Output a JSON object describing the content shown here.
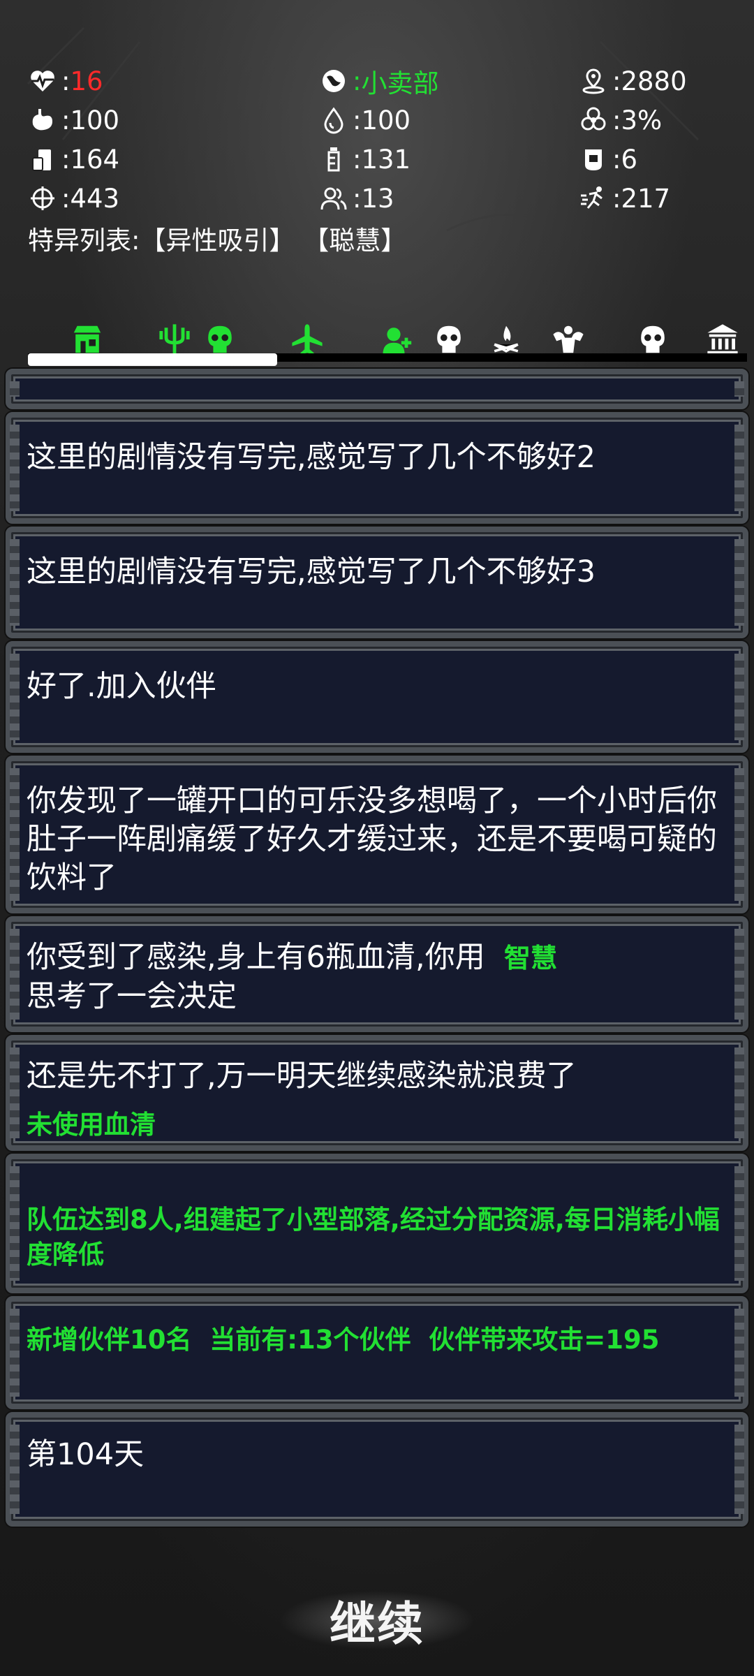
{
  "stats": {
    "health": "16",
    "location": "小卖部",
    "distance": "2880",
    "hunger": "100",
    "thirst": "100",
    "infection": "3%",
    "food": "164",
    "water": "131",
    "serum": "6",
    "attack": "443",
    "companions": "13",
    "speed": "217"
  },
  "stat_icons": [
    "heart-pulse-icon",
    "world-icon",
    "map-pin-icon",
    "stomach-icon",
    "water-drop-icon",
    "biohazard-icon",
    "food-can-icon",
    "water-bottle-icon",
    "serum-bag-icon",
    "crosshair-icon",
    "group-icon",
    "running-icon"
  ],
  "traits": {
    "label": "特异列表:",
    "values": "【异性吸引】 【聪慧】"
  },
  "tabs": [
    "store-icon",
    "trident-icon",
    "skull-icon",
    "airplane-icon",
    "add-user-icon",
    "skull-icon",
    "bonfire-icon",
    "muscle-icon",
    "skull-icon",
    "bank-icon"
  ],
  "tab_progress": 0.33,
  "colors": {
    "accent_green": "#22e033",
    "danger_red": "#ff2a2a",
    "card_bg": "#151a2e"
  },
  "log": {
    "entry1": "这里的剧情没有写完,感觉写了几个不够好2",
    "entry2": "这里的剧情没有写完,感觉写了几个不够好3",
    "entry3": "好了.加入伙伴",
    "entry4": "你发现了一罐开口的可乐没多想喝了，一个小时后你肚子一阵剧痛缓了好久才缓过来，还是不要喝可疑的饮料了",
    "entry5_text": "你受到了感染,身上有6瓶血清,你用",
    "entry5_tag": "智慧",
    "entry5_tail": "思考了一会决定",
    "entry6_text": "还是先不打了,万一明天继续感染就浪费了",
    "entry6_sub": "未使用血清",
    "entry7": "队伍达到8人,组建起了小型部落,经过分配资源,每日消耗小幅度降低",
    "entry8": "新增伙伴10名  当前有:13个伙伴  伙伴带来攻击=195",
    "entry9": "第104天"
  },
  "continue_label": "继续"
}
